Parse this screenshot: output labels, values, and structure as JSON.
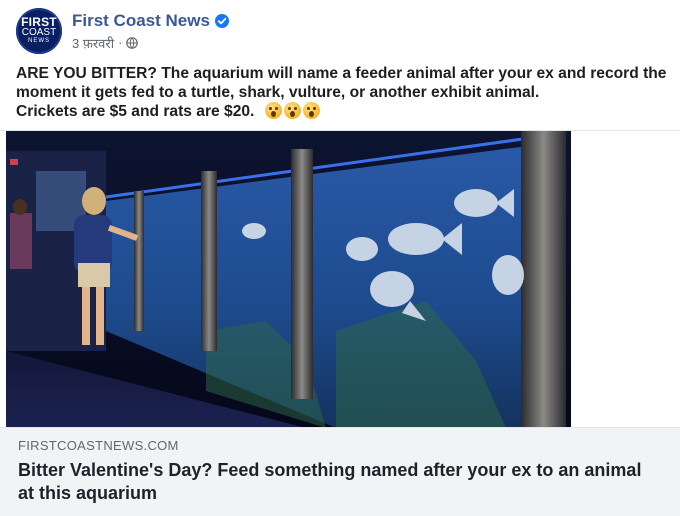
{
  "header": {
    "page_name": "First Coast News",
    "date": "3 फ़रवरी",
    "separator": "·",
    "avatar": {
      "line1": "FIRST",
      "line2": "COAST",
      "line3": "NEWS"
    },
    "verified_icon": "verified-badge-icon",
    "privacy_icon": "globe-icon"
  },
  "post": {
    "line1": "ARE YOU BITTER? The aquarium will name a feeder animal after your ex and record the",
    "line2": "moment it gets fed to a turtle, shark, vulture, or another exhibit animal.",
    "line3": "Crickets are $5 and rats are $20.",
    "emoji_icon": "astonished-face-emoji"
  },
  "link": {
    "domain": "FIRSTCOASTNEWS.COM",
    "title": "Bitter Valentine's Day? Feed something named after your ex to an animal at this aquarium"
  },
  "colors": {
    "brand_blue": "#385898",
    "verified_blue": "#1877f2",
    "link_bg": "#f2f3f5"
  }
}
